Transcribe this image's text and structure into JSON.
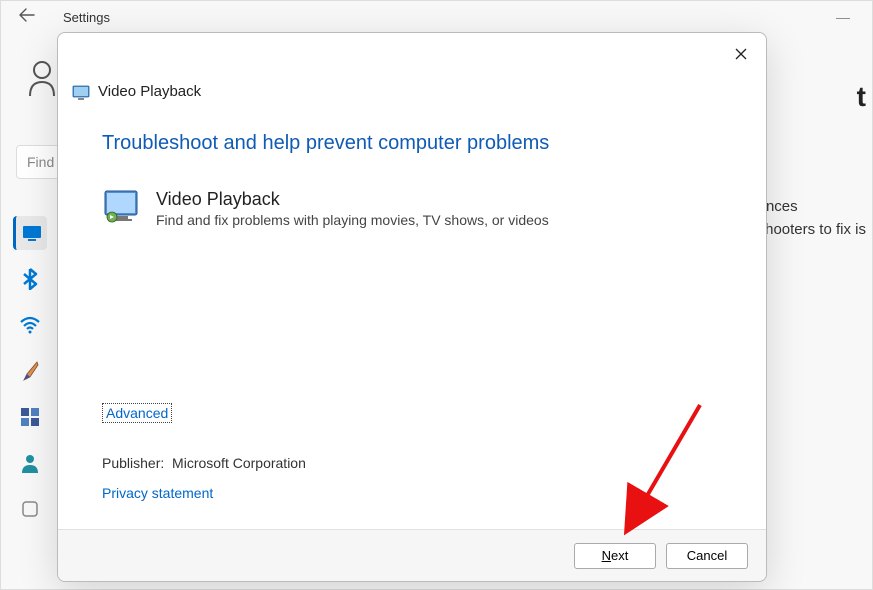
{
  "background": {
    "title": "Settings",
    "search_placeholder": "Find",
    "right_frag": "t",
    "right_text1a": "ences",
    "right_text1b": "shooters to fix is"
  },
  "dialog": {
    "window_title": "Video Playback",
    "heading": "Troubleshoot and help prevent computer problems",
    "item_title": "Video Playback",
    "item_desc": "Find and fix problems with playing movies, TV shows, or videos",
    "advanced": "Advanced",
    "publisher_label": "Publisher:",
    "publisher_value": "Microsoft Corporation",
    "privacy": "Privacy statement",
    "next": "Next",
    "next_accesskey": "N",
    "cancel": "Cancel"
  }
}
